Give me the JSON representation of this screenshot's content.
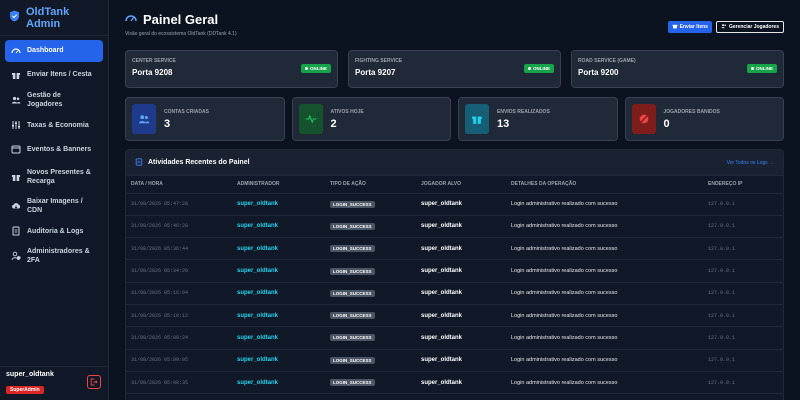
{
  "brand": {
    "title": "OldTank Admin"
  },
  "sidebar": {
    "items": [
      {
        "label": "Dashboard",
        "icon": "dashboard-icon",
        "active": true
      },
      {
        "label": "Enviar Itens / Cesta",
        "icon": "gift-icon"
      },
      {
        "label": "Gestão de Jogadores",
        "icon": "users-icon"
      },
      {
        "label": "Taxas & Economia",
        "icon": "sliders-icon"
      },
      {
        "label": "Eventos & Banners",
        "icon": "calendar-icon"
      },
      {
        "label": "Novos Presentes & Recarga",
        "icon": "gift-box-icon"
      },
      {
        "label": "Baixar Imagens / CDN",
        "icon": "cloud-download-icon"
      },
      {
        "label": "Auditoria & Logs",
        "icon": "file-icon"
      },
      {
        "label": "Administradores & 2FA",
        "icon": "user-shield-icon"
      }
    ],
    "user": {
      "name": "super_oldtank",
      "role": "SuperAdmin"
    }
  },
  "header": {
    "title": "Painel Geral",
    "subtitle": "Visão geral do ecossistema OldTank (DDTank 4.1)",
    "send_items_label": "Enviar Itens",
    "manage_players_label": "Gerenciar Jogadores"
  },
  "services": [
    {
      "label": "CENTER SERVICE",
      "port": "Porta 9208",
      "status": "ONLINE"
    },
    {
      "label": "FIGHTING SERVICE",
      "port": "Porta 9207",
      "status": "ONLINE"
    },
    {
      "label": "ROAD SERVICE (GAME)",
      "port": "Porta 9200",
      "status": "ONLINE"
    }
  ],
  "stats": [
    {
      "label": "CONTAS CRIADAS",
      "value": "3",
      "icon": "users-icon",
      "color": "#1e3a8a",
      "fg": "#60a5fa"
    },
    {
      "label": "ATIVOS HOJE",
      "value": "2",
      "icon": "activity-icon",
      "color": "#14532d",
      "fg": "#22c55e"
    },
    {
      "label": "ENVIOS REALIZADOS",
      "value": "13",
      "icon": "gift-icon",
      "color": "#155e75",
      "fg": "#22d3ee"
    },
    {
      "label": "JOGADORES BANIDOS",
      "value": "0",
      "icon": "ban-icon",
      "color": "#7f1d1d",
      "fg": "#ef4444"
    }
  ],
  "activity": {
    "title": "Atividades Recentes do Painel",
    "view_all": "Ver Todos os Logs →",
    "columns": [
      "DATA / HORA",
      "ADMINISTRADOR",
      "TIPO DE AÇÃO",
      "JOGADOR ALVO",
      "DETALHES DA OPERAÇÃO",
      "ENDEREÇO IP"
    ],
    "rows": [
      {
        "date": "31/08/2026 05:47:28",
        "admin": "super_oldtank",
        "action": "LOGIN_SUCCESS",
        "player": "super_oldtank",
        "details": "Login administrativo realizado com sucesso",
        "ip": "127.0.0.1"
      },
      {
        "date": "31/08/2026 05:46:28",
        "admin": "super_oldtank",
        "action": "LOGIN_SUCCESS",
        "player": "super_oldtank",
        "details": "Login administrativo realizado com sucesso",
        "ip": "127.0.0.1"
      },
      {
        "date": "31/08/2026 05:36:44",
        "admin": "super_oldtank",
        "action": "LOGIN_SUCCESS",
        "player": "super_oldtank",
        "details": "Login administrativo realizado com sucesso",
        "ip": "127.0.0.1"
      },
      {
        "date": "31/08/2026 05:34:20",
        "admin": "super_oldtank",
        "action": "LOGIN_SUCCESS",
        "player": "super_oldtank",
        "details": "Login administrativo realizado com sucesso",
        "ip": "127.0.0.1"
      },
      {
        "date": "31/08/2026 05:16:04",
        "admin": "super_oldtank",
        "action": "LOGIN_SUCCESS",
        "player": "super_oldtank",
        "details": "Login administrativo realizado com sucesso",
        "ip": "127.0.0.1"
      },
      {
        "date": "31/08/2026 05:10:12",
        "admin": "super_oldtank",
        "action": "LOGIN_SUCCESS",
        "player": "super_oldtank",
        "details": "Login administrativo realizado com sucesso",
        "ip": "127.0.0.1"
      },
      {
        "date": "31/08/2026 05:09:24",
        "admin": "super_oldtank",
        "action": "LOGIN_SUCCESS",
        "player": "super_oldtank",
        "details": "Login administrativo realizado com sucesso",
        "ip": "127.0.0.1"
      },
      {
        "date": "31/08/2026 05:09:05",
        "admin": "super_oldtank",
        "action": "LOGIN_SUCCESS",
        "player": "super_oldtank",
        "details": "Login administrativo realizado com sucesso",
        "ip": "127.0.0.1"
      },
      {
        "date": "31/08/2026 05:08:35",
        "admin": "super_oldtank",
        "action": "LOGIN_SUCCESS",
        "player": "super_oldtank",
        "details": "Login administrativo realizado com sucesso",
        "ip": "127.0.0.1"
      }
    ]
  }
}
